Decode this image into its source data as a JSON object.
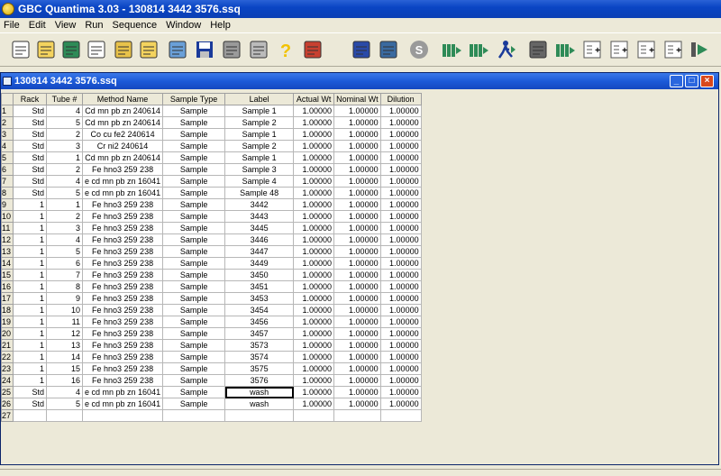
{
  "app": {
    "title": "GBC Quantima 3.03 - 130814 3442 3576.ssq"
  },
  "menu": [
    "File",
    "Edit",
    "View",
    "Run",
    "Sequence",
    "Window",
    "Help"
  ],
  "toolbar": {
    "icons": [
      "new-file-icon",
      "open-book-icon",
      "sequence-icon",
      "edit-doc-icon",
      "edit-pen-icon",
      "open-folder-icon",
      "chart-icon",
      "save-icon",
      "print-icon",
      "print-preview-icon",
      "help-icon",
      "calibrate-icon",
      "autosampler-icon",
      "pump-icon",
      "stop-icon",
      "run-selected-icon",
      "run-next-icon",
      "run-icon",
      "report-icon",
      "standards-icon",
      "add-row-icon",
      "add-n-icon",
      "add-all-icon",
      "add-clear-icon",
      "start-icon"
    ]
  },
  "window": {
    "title": "130814 3442 3576.ssq"
  },
  "table": {
    "columns": [
      "Rack",
      "Tube #",
      "Method Name",
      "Sample Type",
      "Label",
      "Actual Wt",
      "Nominal Wt",
      "Dilution"
    ],
    "rows": [
      [
        "1",
        "Std",
        "4",
        "Cd mn pb zn 240614",
        "Sample",
        "Sample 1",
        "1.00000",
        "1.00000",
        "1.00000"
      ],
      [
        "2",
        "Std",
        "5",
        "Cd mn pb zn 240614",
        "Sample",
        "Sample 2",
        "1.00000",
        "1.00000",
        "1.00000"
      ],
      [
        "3",
        "Std",
        "2",
        "Co cu fe2 240614",
        "Sample",
        "Sample 1",
        "1.00000",
        "1.00000",
        "1.00000"
      ],
      [
        "4",
        "Std",
        "3",
        "Cr ni2 240614",
        "Sample",
        "Sample 2",
        "1.00000",
        "1.00000",
        "1.00000"
      ],
      [
        "5",
        "Std",
        "1",
        "Cd mn pb zn 240614",
        "Sample",
        "Sample 1",
        "1.00000",
        "1.00000",
        "1.00000"
      ],
      [
        "6",
        "Std",
        "2",
        "Fe hno3 259 238",
        "Sample",
        "Sample 3",
        "1.00000",
        "1.00000",
        "1.00000"
      ],
      [
        "7",
        "Std",
        "4",
        "e cd mn pb zn 16041",
        "Sample",
        "Sample 4",
        "1.00000",
        "1.00000",
        "1.00000"
      ],
      [
        "8",
        "Std",
        "5",
        "e cd mn pb zn 16041",
        "Sample",
        "Sample 48",
        "1.00000",
        "1.00000",
        "1.00000"
      ],
      [
        "9",
        "1",
        "1",
        "Fe hno3 259 238",
        "Sample",
        "3442",
        "1.00000",
        "1.00000",
        "1.00000"
      ],
      [
        "10",
        "1",
        "2",
        "Fe hno3 259 238",
        "Sample",
        "3443",
        "1.00000",
        "1.00000",
        "1.00000"
      ],
      [
        "11",
        "1",
        "3",
        "Fe hno3 259 238",
        "Sample",
        "3445",
        "1.00000",
        "1.00000",
        "1.00000"
      ],
      [
        "12",
        "1",
        "4",
        "Fe hno3 259 238",
        "Sample",
        "3446",
        "1.00000",
        "1.00000",
        "1.00000"
      ],
      [
        "13",
        "1",
        "5",
        "Fe hno3 259 238",
        "Sample",
        "3447",
        "1.00000",
        "1.00000",
        "1.00000"
      ],
      [
        "14",
        "1",
        "6",
        "Fe hno3 259 238",
        "Sample",
        "3449",
        "1.00000",
        "1.00000",
        "1.00000"
      ],
      [
        "15",
        "1",
        "7",
        "Fe hno3 259 238",
        "Sample",
        "3450",
        "1.00000",
        "1.00000",
        "1.00000"
      ],
      [
        "16",
        "1",
        "8",
        "Fe hno3 259 238",
        "Sample",
        "3451",
        "1.00000",
        "1.00000",
        "1.00000"
      ],
      [
        "17",
        "1",
        "9",
        "Fe hno3 259 238",
        "Sample",
        "3453",
        "1.00000",
        "1.00000",
        "1.00000"
      ],
      [
        "18",
        "1",
        "10",
        "Fe hno3 259 238",
        "Sample",
        "3454",
        "1.00000",
        "1.00000",
        "1.00000"
      ],
      [
        "19",
        "1",
        "11",
        "Fe hno3 259 238",
        "Sample",
        "3456",
        "1.00000",
        "1.00000",
        "1.00000"
      ],
      [
        "20",
        "1",
        "12",
        "Fe hno3 259 238",
        "Sample",
        "3457",
        "1.00000",
        "1.00000",
        "1.00000"
      ],
      [
        "21",
        "1",
        "13",
        "Fe hno3 259 238",
        "Sample",
        "3573",
        "1.00000",
        "1.00000",
        "1.00000"
      ],
      [
        "22",
        "1",
        "14",
        "Fe hno3 259 238",
        "Sample",
        "3574",
        "1.00000",
        "1.00000",
        "1.00000"
      ],
      [
        "23",
        "1",
        "15",
        "Fe hno3 259 238",
        "Sample",
        "3575",
        "1.00000",
        "1.00000",
        "1.00000"
      ],
      [
        "24",
        "1",
        "16",
        "Fe hno3 259 238",
        "Sample",
        "3576",
        "1.00000",
        "1.00000",
        "1.00000"
      ],
      [
        "25",
        "Std",
        "4",
        "e cd mn pb zn 16041",
        "Sample",
        "wash",
        "1.00000",
        "1.00000",
        "1.00000"
      ],
      [
        "26",
        "Std",
        "5",
        "e cd mn pb zn 16041",
        "Sample",
        "wash",
        "1.00000",
        "1.00000",
        "1.00000"
      ],
      [
        "27",
        "",
        "",
        "",
        "",
        "",
        "",
        "",
        ""
      ]
    ],
    "selected_cell": {
      "row": 24,
      "col": 5
    }
  }
}
